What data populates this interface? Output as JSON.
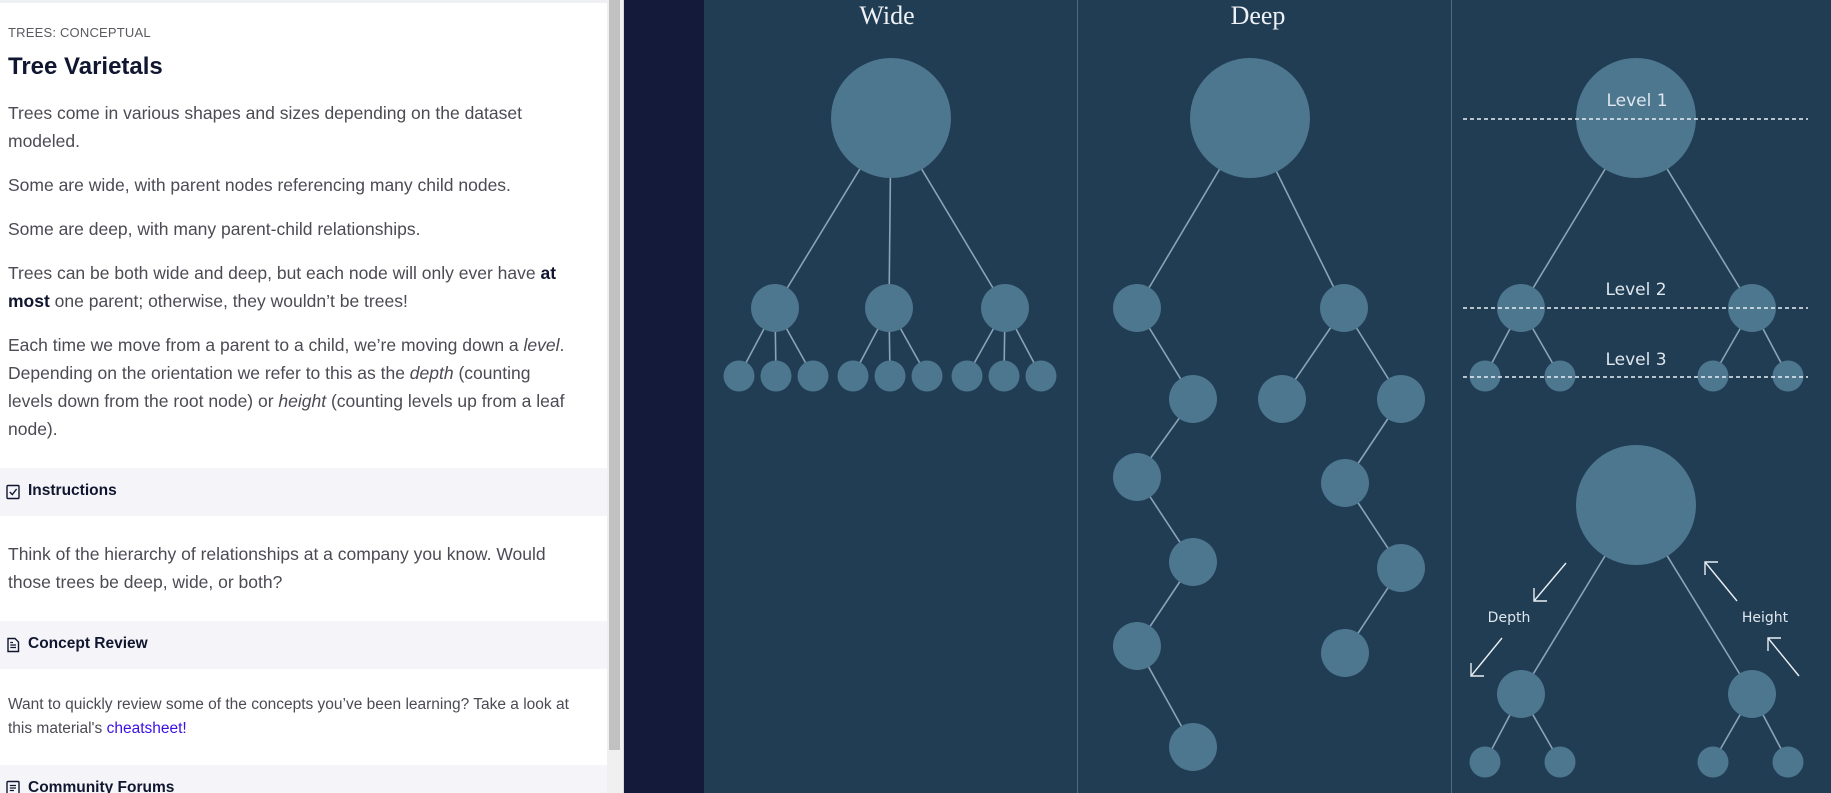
{
  "lesson": {
    "breadcrumb": "TREES: CONCEPTUAL",
    "title": "Tree Varietals",
    "p1": "Trees come in various shapes and sizes depending on the dataset modeled.",
    "p2": "Some are wide, with parent nodes referencing many child nodes.",
    "p3": "Some are deep, with many parent-child relationships.",
    "p4_before": "Trees can be both wide and deep, but each node will only ever have ",
    "p4_bold": "at most",
    "p4_after": " one parent; otherwise, they wouldn’t be trees!",
    "p5_a": "Each time we move from a parent to a child, we’re moving down a ",
    "p5_level": "level",
    "p5_b": ". Depending on the orientation we refer to this as the ",
    "p5_depth": "depth",
    "p5_c": " (counting levels down from the root node) or ",
    "p5_height": "height",
    "p5_d": " (counting levels up from a leaf node)."
  },
  "instructions": {
    "label": "Instructions",
    "icon": "checkbox-icon",
    "text": "Think of the hierarchy of relationships at a company you know. Would those trees be deep, wide, or both?"
  },
  "concept_review": {
    "label": "Concept Review",
    "icon": "document-icon",
    "text_before": "Want to quickly review some of the concepts you’ve been learning? Take a look at this material's ",
    "link": "cheatsheet!"
  },
  "community": {
    "label": "Community Forums",
    "icon": "forum-icon"
  },
  "diagram": {
    "wide_label": "Wide",
    "deep_label": "Deep",
    "level1": "Level 1",
    "level2": "Level 2",
    "level3": "Level 3",
    "depth_label": "Depth",
    "height_label": "Height",
    "colors": {
      "panel": "#213d54",
      "outer": "#131a3a",
      "node": "#4d768f",
      "line": "#8aa3b5",
      "text": "#dfe7ee"
    }
  }
}
